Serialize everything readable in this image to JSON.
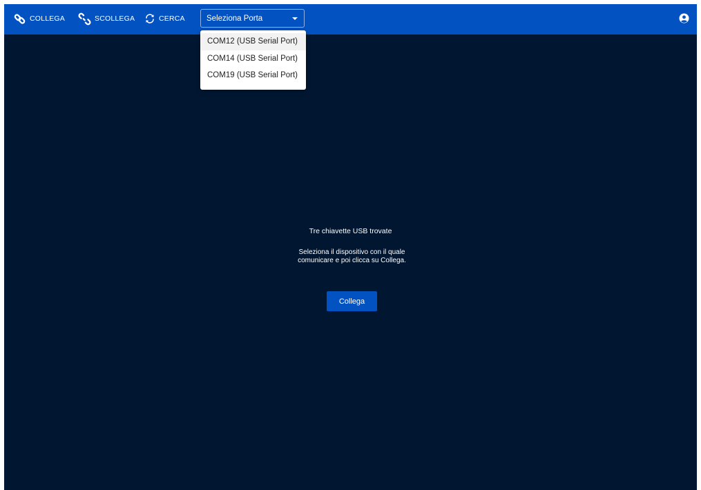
{
  "toolbar": {
    "connect_label": "COLLEGA",
    "disconnect_label": "SCOLLEGA",
    "search_label": "CERCA",
    "port_select": {
      "selected": "Seleziona Porta"
    }
  },
  "dropdown": {
    "options": [
      "COM12 (USB Serial Port)",
      "COM14 (USB Serial Port)",
      "COM19 (USB Serial Port)"
    ]
  },
  "main": {
    "title": "Tre chiavette USB trovate",
    "description": "Seleziona il dispositivo con il quale comunicare e poi clicca su Collega.",
    "connect_button": "Collega"
  },
  "colors": {
    "toolbar": "#0352c2",
    "background": "#011731",
    "button": "#0352c2"
  },
  "icons": {
    "connect": "link-icon",
    "disconnect": "unlink-icon",
    "search": "refresh-icon",
    "dropdown": "caret-down-icon",
    "user": "user-circle-icon"
  }
}
